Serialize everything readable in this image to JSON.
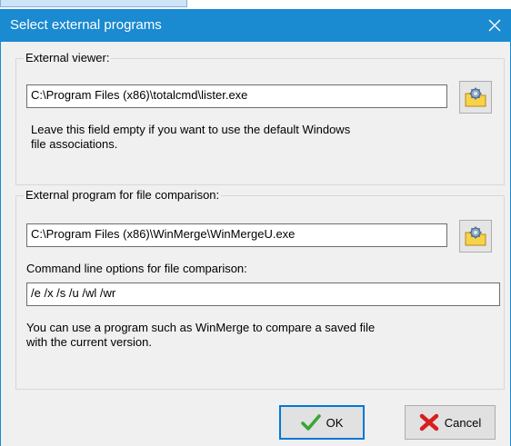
{
  "window": {
    "title": "Select external programs",
    "close_icon": "close-icon"
  },
  "viewer": {
    "legend": "External viewer:",
    "path": "C:\\Program Files (x86)\\totalcmd\\lister.exe",
    "note_line1": "Leave this field empty if you want to use the default Windows",
    "note_line2": "file associations.",
    "browse_icon": "folder-gear-icon"
  },
  "compare": {
    "legend": "External program for file comparison:",
    "path": "C:\\Program Files (x86)\\WinMerge\\WinMergeU.exe",
    "options_label": "Command line options for file comparison:",
    "options": "/e /x /s /u /wl /wr",
    "note_line1": "You can use a program such as WinMerge to compare a saved file",
    "note_line2": "with the current version.",
    "browse_icon": "folder-gear-icon"
  },
  "buttons": {
    "ok": "OK",
    "ok_icon": "checkmark-icon",
    "cancel": "Cancel",
    "cancel_icon": "red-x-icon"
  },
  "colors": {
    "titlebar": "#1a8ad1",
    "ok_border": "#0078d7"
  }
}
